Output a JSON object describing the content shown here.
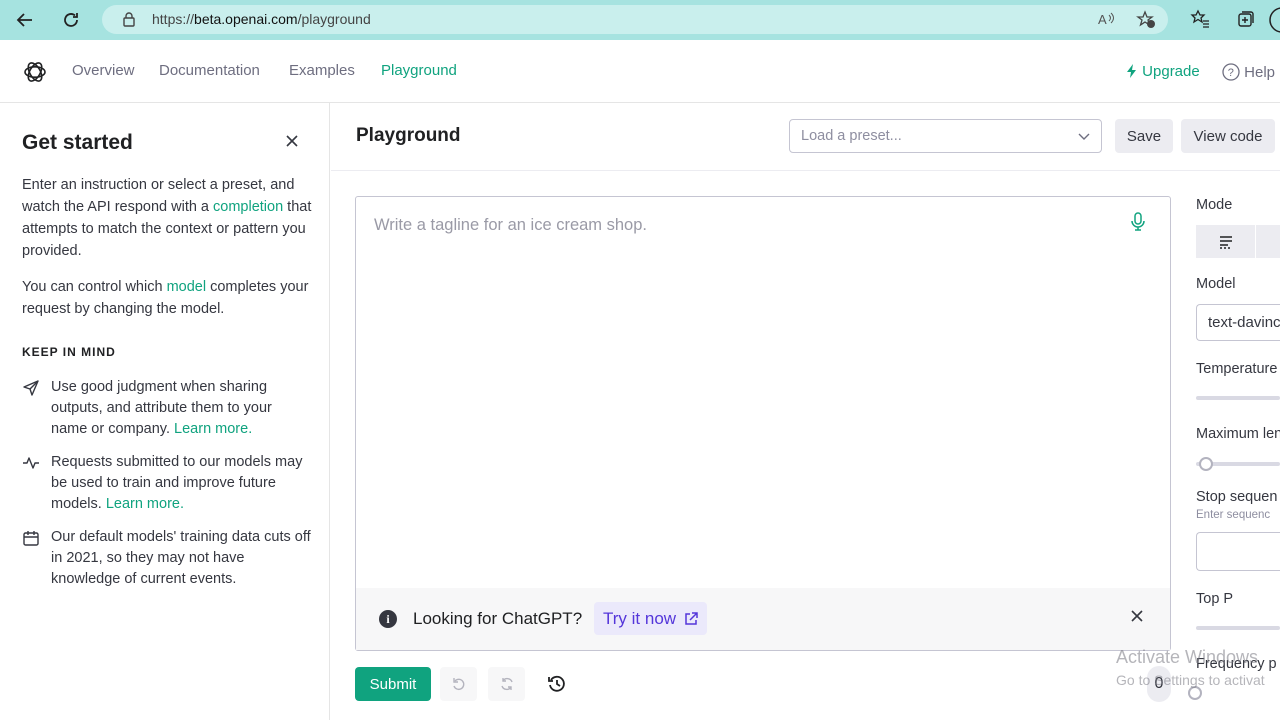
{
  "browser": {
    "url_prefix": "https://",
    "url_host": "beta.openai.com",
    "url_path": "/playground",
    "back_icon": "arrow-left-icon",
    "refresh_icon": "refresh-icon",
    "lock_icon": "lock-icon"
  },
  "topnav": {
    "links": [
      "Overview",
      "Documentation",
      "Examples",
      "Playground"
    ],
    "active": "Playground",
    "upgrade": "Upgrade",
    "help": "Help",
    "accent": "#10a37f"
  },
  "sidebar": {
    "title": "Get started",
    "intro_1": "Enter an instruction or select a preset, and watch the API respond with a",
    "intro_link": "completion",
    "intro_2": " that attempts to match the context or pattern you provided.",
    "control_1": "You can control which ",
    "control_link": "model",
    "control_2": " completes your request by changing the model.",
    "keep_in_mind": "KEEP IN MIND",
    "tips": [
      {
        "icon": "send-icon",
        "text": "Use good judgment when sharing outputs, and attribute them to your name or company. ",
        "link": "Learn more."
      },
      {
        "icon": "activity-icon",
        "text": "Requests submitted to our models may be used to train and improve future models. ",
        "link": "Learn more."
      },
      {
        "icon": "calendar-icon",
        "text": "Our default models' training data cuts off in 2021, so they may not have knowledge of current events.",
        "link": ""
      }
    ]
  },
  "main": {
    "title": "Playground",
    "preset_placeholder": "Load a preset...",
    "save": "Save",
    "view_code": "View code",
    "editor_placeholder": "Write a tagline for an ice cream shop.",
    "banner_text": "Looking for ChatGPT?",
    "banner_link": "Try it now",
    "submit": "Submit",
    "token_count": "0"
  },
  "settings": {
    "mode_label": "Mode",
    "model_label": "Model",
    "model_value": "text-davinci",
    "temperature_label": "Temperature",
    "max_length_label": "Maximum len",
    "stop_label": "Stop sequen",
    "stop_hint": "Enter sequenc",
    "top_p_label": "Top P",
    "frequency_label": "Frequency p"
  },
  "watermark": {
    "line1": "Activate Windows",
    "line2": "Go to Settings to activat"
  }
}
